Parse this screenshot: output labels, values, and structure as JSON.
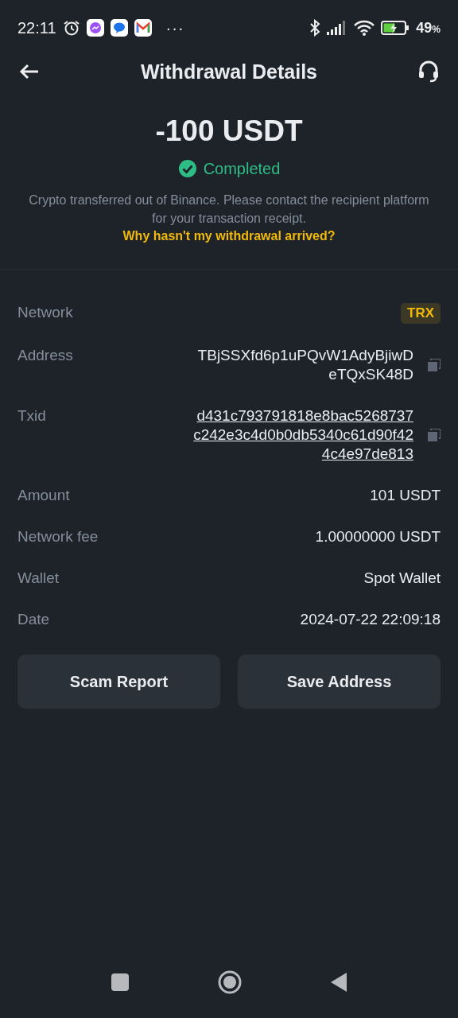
{
  "status_bar": {
    "time": "22:11",
    "more": "···",
    "battery": "49",
    "battery_unit": "%"
  },
  "header": {
    "title": "Withdrawal Details"
  },
  "summary": {
    "amount": "-100 USDT",
    "status": "Completed",
    "completed": true,
    "description": "Crypto transferred out of Binance. Please contact the recipient platform for your transaction receipt.",
    "help_link": "Why hasn't my withdrawal arrived?"
  },
  "details": [
    {
      "label": "Network",
      "value": "TRX",
      "kind": "badge"
    },
    {
      "label": "Address",
      "value": "TBjSSXfd6p1uPQvW1AdyBjiwDeTQxSK48D",
      "kind": "copyable",
      "link": false
    },
    {
      "label": "Txid",
      "value": "d431c793791818e8bac5268737c242e3c4d0b0db5340c61d90f424c4e97de813",
      "kind": "copyable",
      "link": true
    },
    {
      "label": "Amount",
      "value": "101 USDT",
      "kind": "text"
    },
    {
      "label": "Network fee",
      "value": "1.00000000 USDT",
      "kind": "text"
    },
    {
      "label": "Wallet",
      "value": "Spot Wallet",
      "kind": "text"
    },
    {
      "label": "Date",
      "value": "2024-07-22 22:09:18",
      "kind": "text"
    }
  ],
  "buttons": [
    "Scam Report",
    "Save Address"
  ]
}
